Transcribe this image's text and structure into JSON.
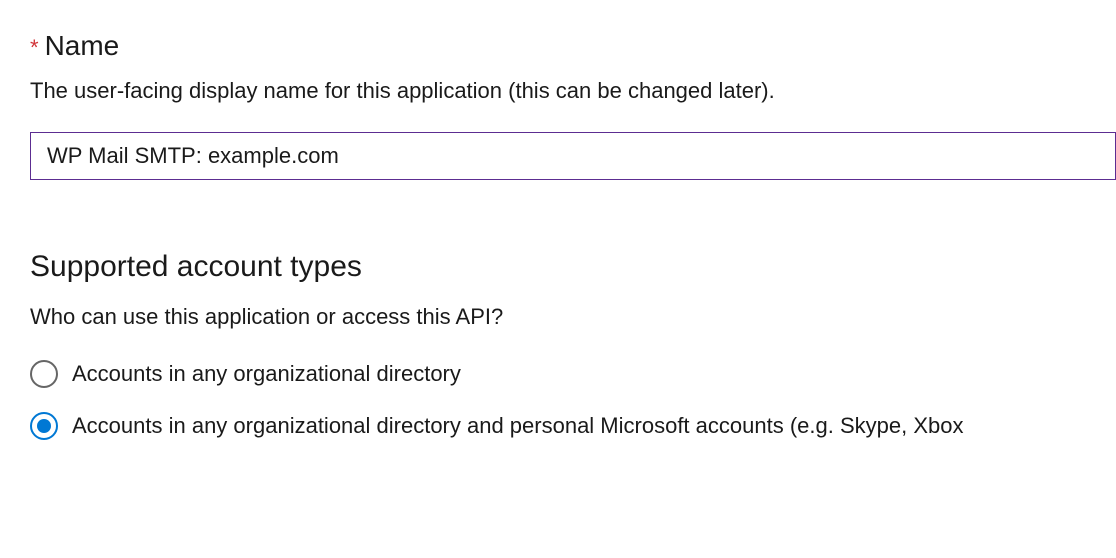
{
  "nameField": {
    "label": "Name",
    "requiredMark": "*",
    "description": "The user-facing display name for this application (this can be changed later).",
    "value": "WP Mail SMTP: example.com"
  },
  "accountTypes": {
    "heading": "Supported account types",
    "subheading": "Who can use this application or access this API?",
    "options": [
      {
        "label": "Accounts in any organizational directory",
        "selected": false
      },
      {
        "label": "Accounts in any organizational directory and personal Microsoft accounts (e.g. Skype, Xbox",
        "selected": true
      }
    ]
  }
}
